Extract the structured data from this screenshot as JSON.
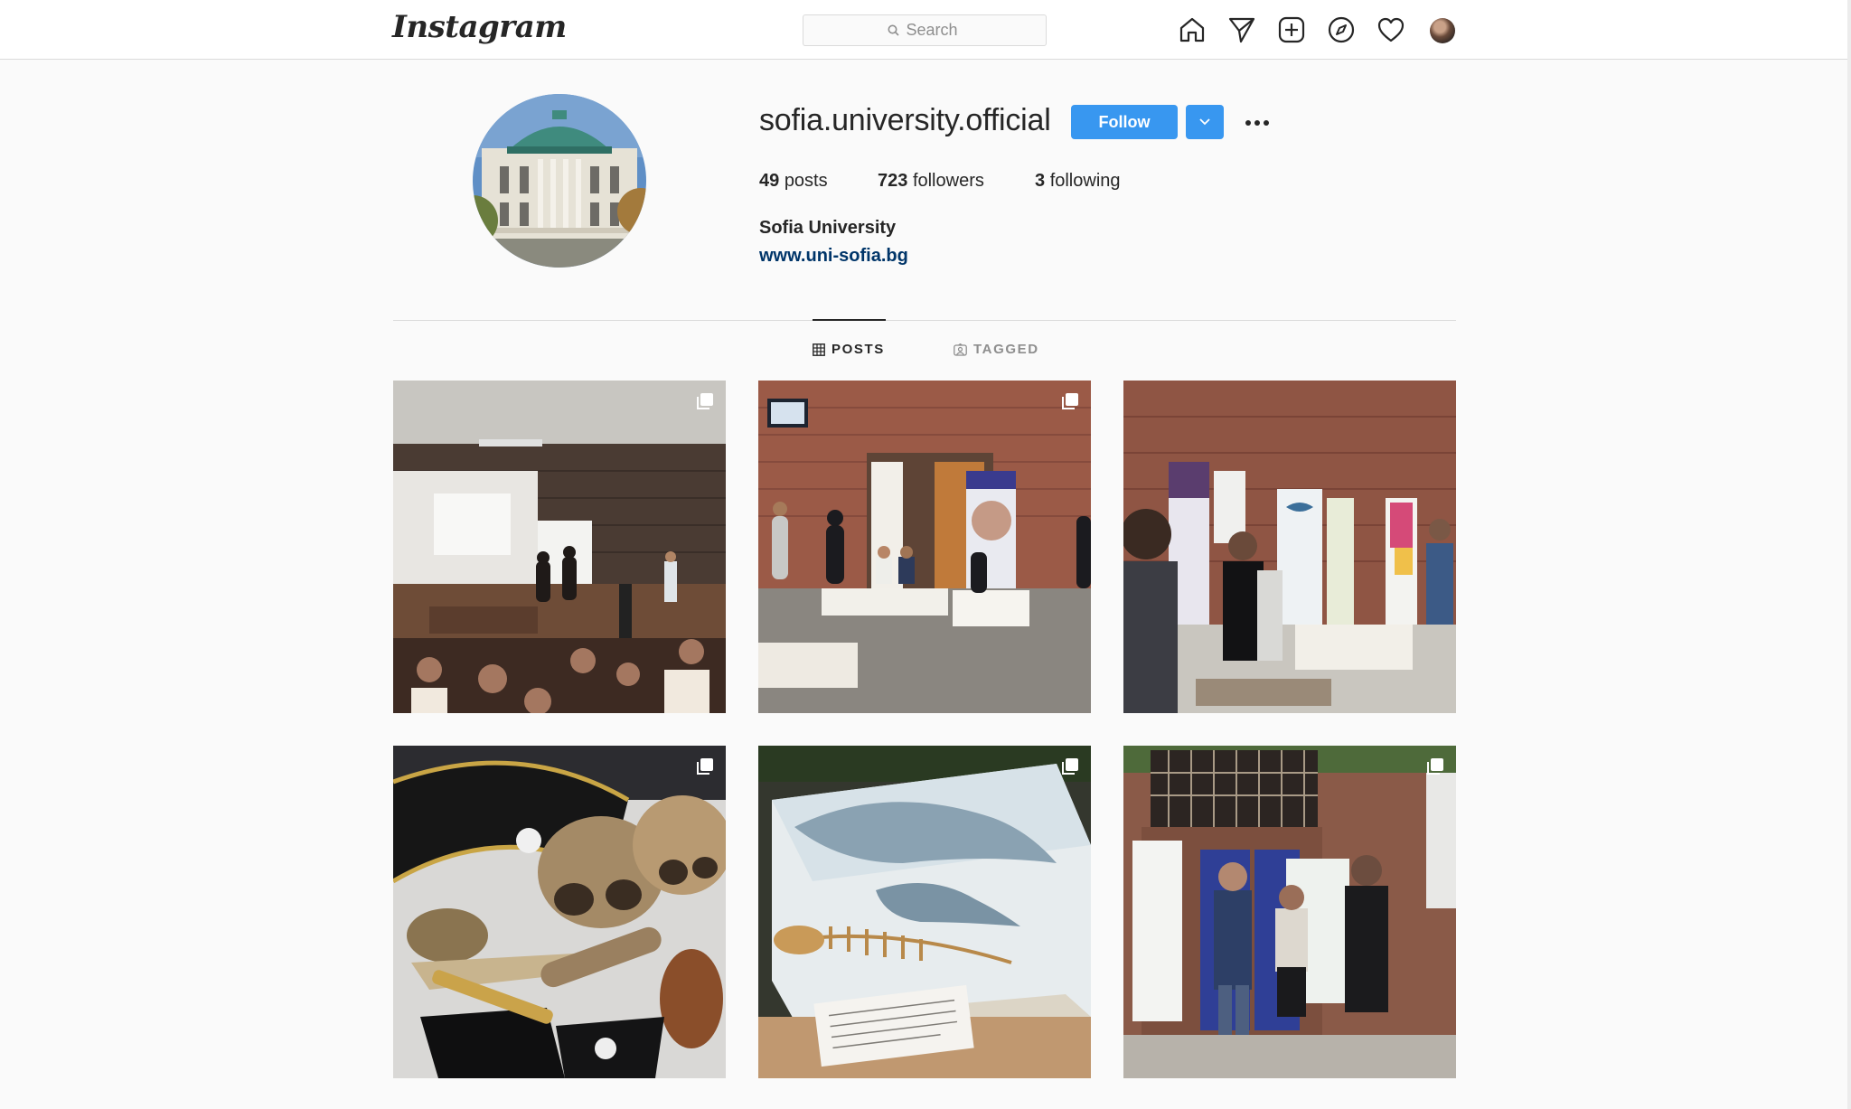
{
  "header": {
    "logo_text": "Instagram",
    "search_placeholder": "Search",
    "nav_icons": [
      "home-icon",
      "direct-icon",
      "new-post-icon",
      "explore-icon",
      "activity-heart-icon",
      "profile-avatar"
    ]
  },
  "profile": {
    "username": "sofia.university.official",
    "follow_label": "Follow",
    "stats": {
      "posts_count": "49",
      "posts_label": "posts",
      "followers_count": "723",
      "followers_label": "followers",
      "following_count": "3",
      "following_label": "following"
    },
    "full_name": "Sofia University",
    "website": "www.uni-sofia.bg"
  },
  "tabs": {
    "posts_label": "POSTS",
    "tagged_label": "TAGGED",
    "active": "POSTS"
  },
  "posts": [
    {
      "scene": "lecture-hall",
      "multi": true
    },
    {
      "scene": "fair-hall",
      "multi": true
    },
    {
      "scene": "fair-outdoor",
      "multi": false
    },
    {
      "scene": "skulls-pirate",
      "multi": true
    },
    {
      "scene": "dolphin-skeleton",
      "multi": true
    },
    {
      "scene": "ceremony",
      "multi": true
    }
  ],
  "colors": {
    "accent_button": "#3897f0",
    "link": "#003569",
    "border": "#dbdbdb",
    "background": "#fafafa"
  }
}
